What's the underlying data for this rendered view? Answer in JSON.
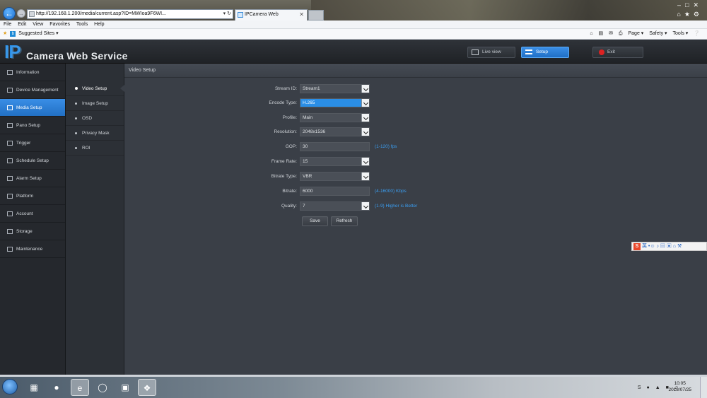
{
  "browser": {
    "address": "http://192.168.1.200/media/current.asp?ID=MWIoa9F6WI...",
    "tab_title": "IPCamera Web",
    "menu": [
      "File",
      "Edit",
      "View",
      "Favorites",
      "Tools",
      "Help"
    ],
    "favorites_label": "Suggested Sites ▾",
    "command_bar": [
      "Page ▾",
      "Safety ▾",
      "Tools ▾"
    ]
  },
  "app": {
    "logo_ip": "IP",
    "logo_title": "Camera Web Service",
    "header_buttons": {
      "live": "Live view",
      "setup": "Setup",
      "exit": "Exit"
    }
  },
  "sidebar": {
    "items": [
      {
        "label": "Information",
        "icon": "information-icon"
      },
      {
        "label": "Device Management",
        "icon": "gear-icon"
      },
      {
        "label": "Media Setup",
        "icon": "media-icon"
      },
      {
        "label": "Pano Setup",
        "icon": "panorama-icon"
      },
      {
        "label": "Trigger",
        "icon": "trigger-icon"
      },
      {
        "label": "Schedule Setup",
        "icon": "schedule-icon"
      },
      {
        "label": "Alarm Setup",
        "icon": "alarm-icon"
      },
      {
        "label": "Platform",
        "icon": "platform-icon"
      },
      {
        "label": "Account",
        "icon": "account-icon"
      },
      {
        "label": "Storage",
        "icon": "storage-icon"
      },
      {
        "label": "Maintenance",
        "icon": "wrench-icon"
      }
    ],
    "active_index": 2
  },
  "subnav": {
    "items": [
      "Video Setup",
      "Image Setup",
      "OSD",
      "Privacy Mask",
      "ROI"
    ],
    "active_index": 0
  },
  "content": {
    "title": "Video Setup",
    "fields": {
      "stream_id": {
        "label": "Stream ID:",
        "value": "Stream1"
      },
      "encode_type": {
        "label": "Encode Type:",
        "value": "H.265"
      },
      "profile": {
        "label": "Profile:",
        "value": "Main"
      },
      "resolution": {
        "label": "Resolution:",
        "value": "2048x1536"
      },
      "gop": {
        "label": "GOP:",
        "value": "30",
        "hint": "(1-120)  fps"
      },
      "frame_rate": {
        "label": "Frame Rate:",
        "value": "15"
      },
      "bitrate_type": {
        "label": "Bitrate Type:",
        "value": "VBR"
      },
      "bitrate": {
        "label": "Bitrate:",
        "value": "6000",
        "hint": "(4-16000) Kbps"
      },
      "quality": {
        "label": "Quality:",
        "value": "7",
        "hint": "(1-9) Higher is Better"
      }
    },
    "buttons": {
      "save": "Save",
      "refresh": "Refresh"
    }
  },
  "ime": {
    "badge": "S",
    "text": "英 •☺ ♪ ▤ ▣ ⌂ ⚒"
  },
  "taskbar": {
    "time": "10:05",
    "date": "2018/07/25"
  },
  "colors": {
    "accent": "#2a8ee6",
    "hint": "#3a9df0",
    "content_bg": "#3a3f47",
    "sidebar_bg": "#25282d"
  }
}
